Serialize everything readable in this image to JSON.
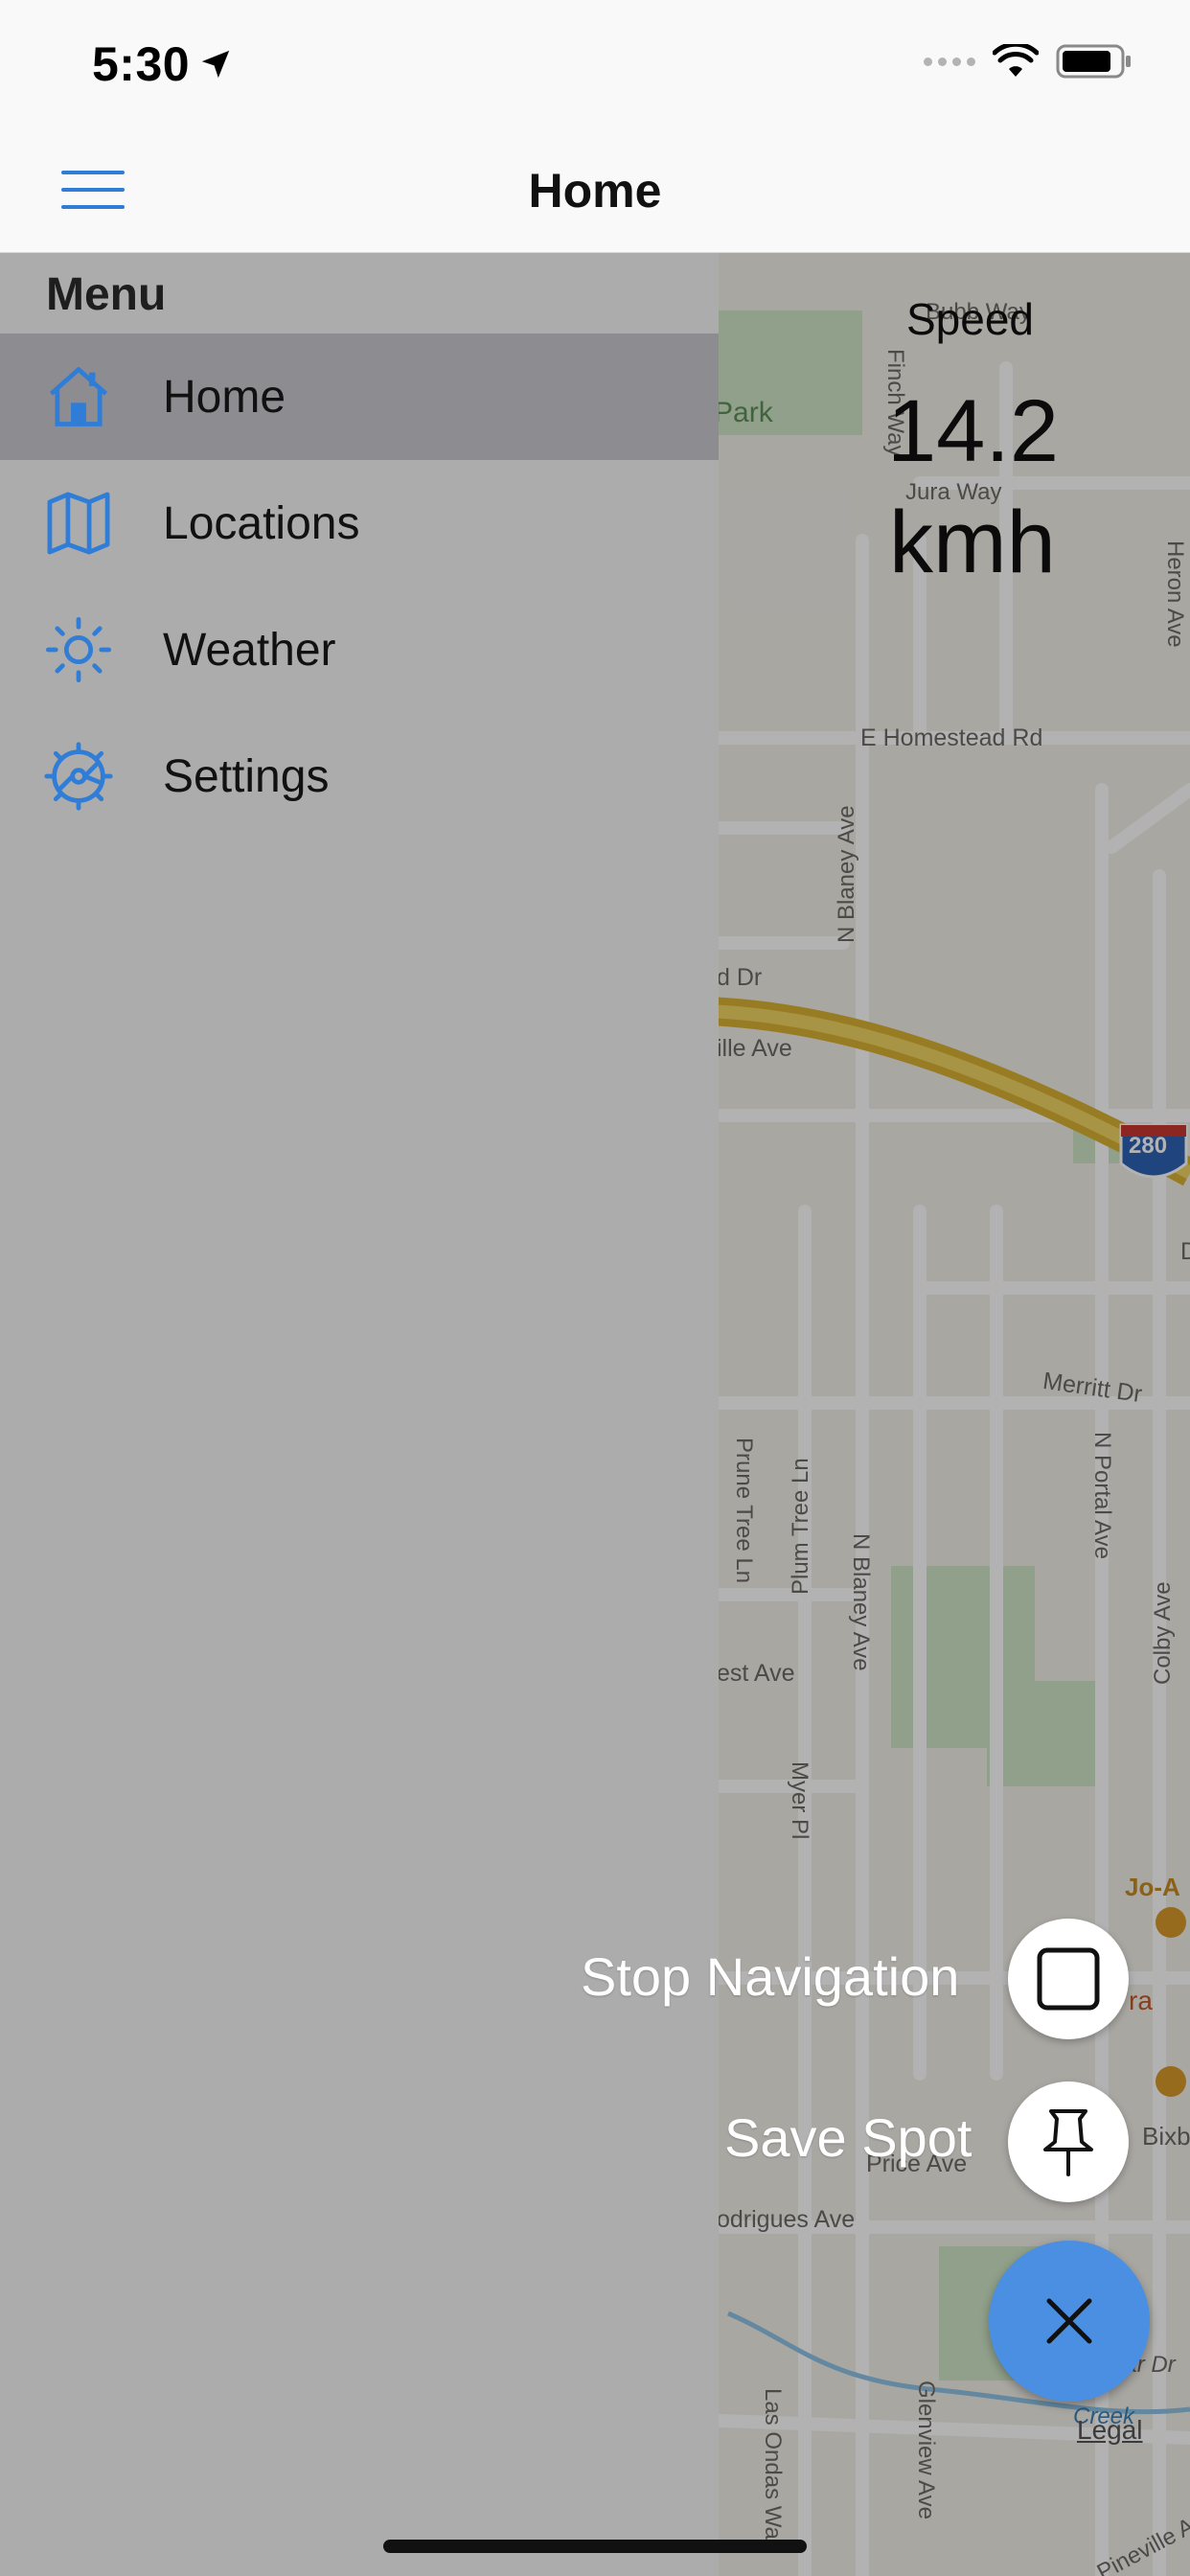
{
  "status_bar": {
    "time": "5:30"
  },
  "nav": {
    "title": "Home"
  },
  "speed": {
    "label": "Speed",
    "value": "14.2",
    "unit": "kmh"
  },
  "menu": {
    "header": "Menu",
    "items": [
      {
        "label": "Home",
        "icon": "home-icon",
        "active": true
      },
      {
        "label": "Locations",
        "icon": "map-icon",
        "active": false
      },
      {
        "label": "Weather",
        "icon": "sun-icon",
        "active": false
      },
      {
        "label": "Settings",
        "icon": "gear-icon",
        "active": false
      }
    ]
  },
  "actions": {
    "stop_navigation": "Stop Navigation",
    "save_spot": "Save Spot"
  },
  "map": {
    "labels": {
      "park": "a Park",
      "finch_way": "Finch Way",
      "jura_way": "Jura Way",
      "bubb_way": "Bubb Way",
      "homestead": "E Homestead Rd",
      "n_blaney_1": "N Blaney Ave",
      "d_dr": "d Dr",
      "ille_ave": "ille Ave",
      "merritt": "Merritt Dr",
      "prune_tree": "Prune Tree Ln",
      "plum_tree": "Plum Tree Ln",
      "n_blaney_2": "N Blaney Ave",
      "n_portal": "N Portal Ave",
      "colby": "Colby Ave",
      "est_ave": "est Ave",
      "myer_pl": "Myer Pl",
      "jo_ann": "Jo-A",
      "ra": "ra",
      "bixb": "Bixb",
      "price_ave": "Price Ave",
      "rodrigues": "odrigues Ave",
      "las_ondas": "Las Ondas Way",
      "glenview": "Glenview Ave",
      "la_mar": "La Mar Dr",
      "creek": "Creek",
      "pineville": "Pineville Av",
      "heron": "Heron Ave",
      "d_label": "D",
      "shield": "280"
    },
    "legal": "Legal"
  },
  "colors": {
    "accent": "#2f7dd6",
    "menu_bg": "#acacac",
    "menu_active": "#8d8c91",
    "fab": "#4a8fe2",
    "freeway": "#e7c33e"
  }
}
